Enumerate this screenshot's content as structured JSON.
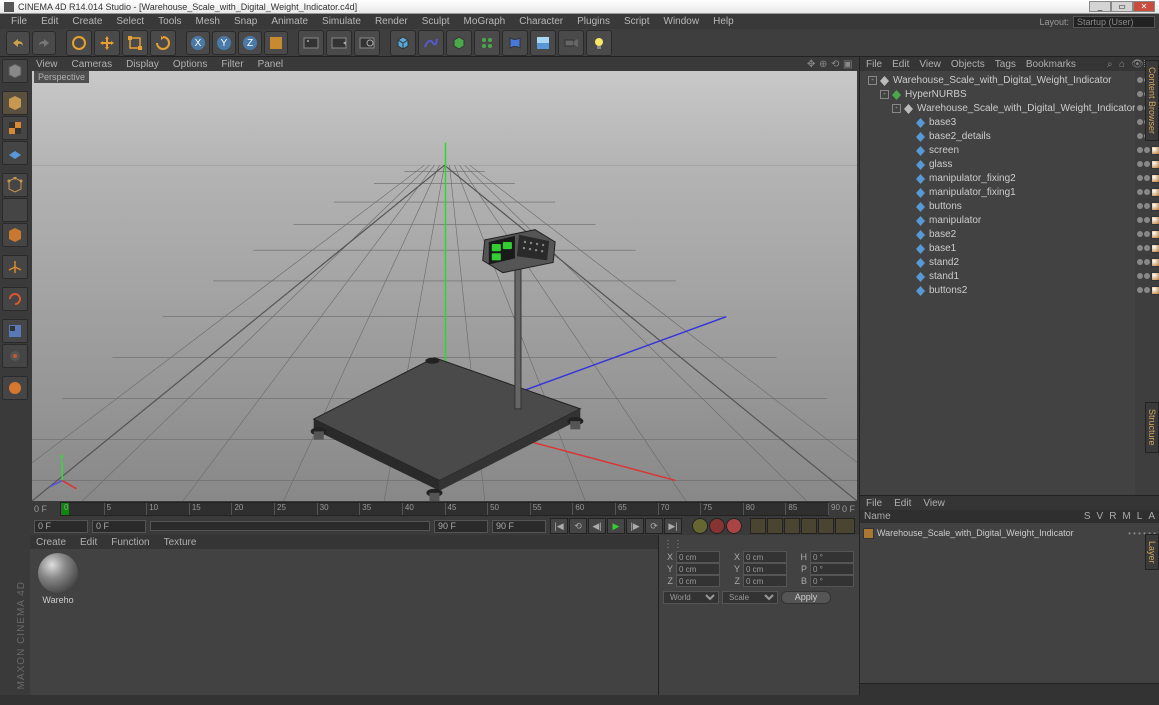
{
  "title": "CINEMA 4D R14.014 Studio - [Warehouse_Scale_with_Digital_Weight_Indicator.c4d]",
  "menubar": [
    "File",
    "Edit",
    "Create",
    "Select",
    "Tools",
    "Mesh",
    "Snap",
    "Animate",
    "Simulate",
    "Render",
    "Sculpt",
    "MoGraph",
    "Character",
    "Plugins",
    "Script",
    "Window",
    "Help"
  ],
  "layout": {
    "label": "Layout:",
    "value": "Startup (User)"
  },
  "view_menubar": [
    "View",
    "Cameras",
    "Display",
    "Options",
    "Filter",
    "Panel"
  ],
  "viewport_label": "Perspective",
  "timeline": {
    "start": "0 F",
    "end": "0 F",
    "ticks": [
      0,
      5,
      10,
      15,
      20,
      25,
      30,
      35,
      40,
      45,
      50,
      55,
      60,
      65,
      70,
      75,
      80,
      85,
      90
    ]
  },
  "framebar": {
    "left1": "0 F",
    "left2": "0 F",
    "right1": "90 F",
    "right2": "90 F"
  },
  "mat_menubar": [
    "Create",
    "Edit",
    "Function",
    "Texture"
  ],
  "material": {
    "name": "Wareho"
  },
  "coords": {
    "rows": [
      {
        "l1": "X",
        "v1": "0 cm",
        "l2": "X",
        "v2": "0 cm",
        "l3": "H",
        "v3": "0 °"
      },
      {
        "l1": "Y",
        "v1": "0 cm",
        "l2": "Y",
        "v2": "0 cm",
        "l3": "P",
        "v3": "0 °"
      },
      {
        "l1": "Z",
        "v1": "0 cm",
        "l2": "Z",
        "v2": "0 cm",
        "l3": "B",
        "v3": "0 °"
      }
    ],
    "sel1": "World",
    "sel2": "Scale",
    "apply": "Apply"
  },
  "obj_menubar": [
    "File",
    "Edit",
    "View",
    "Objects",
    "Tags",
    "Bookmarks"
  ],
  "tree": [
    {
      "depth": 0,
      "exp": "-",
      "type": "null",
      "name": "Warehouse_Scale_with_Digital_Weight_Indicator",
      "tags": [
        "yellow"
      ]
    },
    {
      "depth": 1,
      "exp": "-",
      "type": "hn",
      "name": "HyperNURBS",
      "tags": [
        "green",
        "check"
      ]
    },
    {
      "depth": 2,
      "exp": "-",
      "type": "null",
      "name": "Warehouse_Scale_with_Digital_Weight_Indicator",
      "tags": []
    },
    {
      "depth": 3,
      "exp": "",
      "type": "poly",
      "name": "base3",
      "tags": [
        "phong",
        "tex",
        "tex"
      ]
    },
    {
      "depth": 3,
      "exp": "",
      "type": "poly",
      "name": "base2_details",
      "tags": [
        "phong",
        "tex",
        "tex"
      ]
    },
    {
      "depth": 3,
      "exp": "",
      "type": "poly",
      "name": "screen",
      "tags": [
        "phong",
        "tex",
        "tex"
      ]
    },
    {
      "depth": 3,
      "exp": "",
      "type": "poly",
      "name": "glass",
      "tags": [
        "phong",
        "tex",
        "tex"
      ]
    },
    {
      "depth": 3,
      "exp": "",
      "type": "poly",
      "name": "manipulator_fixing2",
      "tags": [
        "phong",
        "tex",
        "tex"
      ]
    },
    {
      "depth": 3,
      "exp": "",
      "type": "poly",
      "name": "manipulator_fixing1",
      "tags": [
        "phong",
        "tex",
        "tex"
      ]
    },
    {
      "depth": 3,
      "exp": "",
      "type": "poly",
      "name": "buttons",
      "tags": [
        "phong",
        "tex",
        "tex"
      ]
    },
    {
      "depth": 3,
      "exp": "",
      "type": "poly",
      "name": "manipulator",
      "tags": [
        "phong",
        "tex",
        "tex"
      ]
    },
    {
      "depth": 3,
      "exp": "",
      "type": "poly",
      "name": "base2",
      "tags": [
        "phong",
        "tex",
        "tex"
      ]
    },
    {
      "depth": 3,
      "exp": "",
      "type": "poly",
      "name": "base1",
      "tags": [
        "phong",
        "tex",
        "tex"
      ]
    },
    {
      "depth": 3,
      "exp": "",
      "type": "poly",
      "name": "stand2",
      "tags": [
        "phong",
        "tex",
        "tex"
      ]
    },
    {
      "depth": 3,
      "exp": "",
      "type": "poly",
      "name": "stand1",
      "tags": [
        "phong",
        "tex",
        "tex"
      ]
    },
    {
      "depth": 3,
      "exp": "",
      "type": "poly",
      "name": "buttons2",
      "tags": [
        "phong",
        "tex",
        "tex"
      ]
    }
  ],
  "attr_menubar": [
    "File",
    "Edit",
    "View"
  ],
  "attr_hdr": {
    "name": "Name",
    "cols": [
      "S",
      "V",
      "R",
      "M",
      "L",
      "A"
    ]
  },
  "attr_item": "Warehouse_Scale_with_Digital_Weight_Indicator",
  "watermark": "MAXON CINEMA 4D",
  "right_tabs": [
    "Content Browser",
    "Structure",
    "Layer"
  ]
}
